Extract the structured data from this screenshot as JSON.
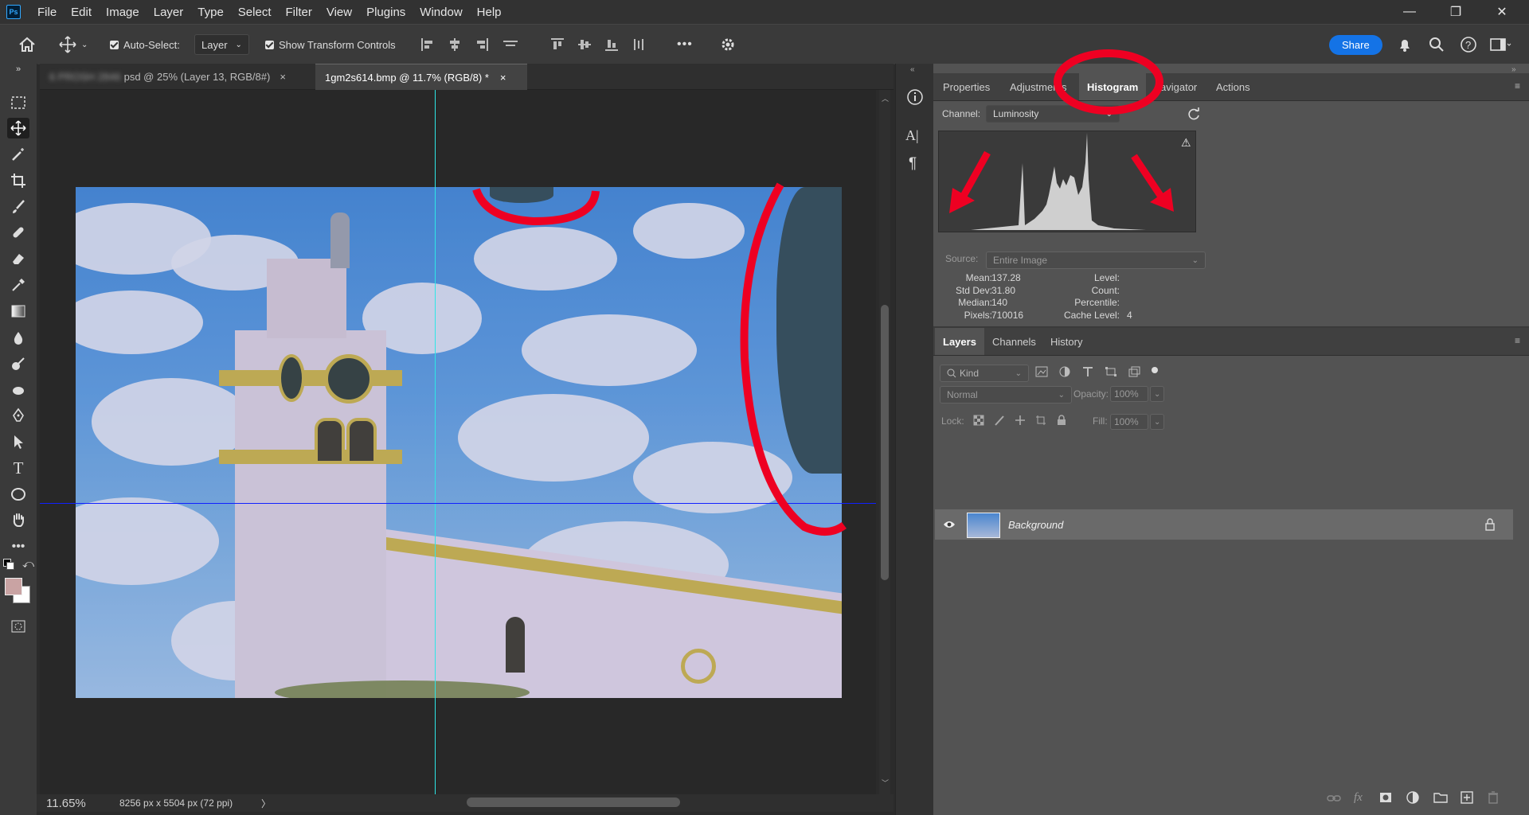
{
  "app": {
    "logo": "Ps"
  },
  "menu": [
    "File",
    "Edit",
    "Image",
    "Layer",
    "Type",
    "Select",
    "Filter",
    "View",
    "Plugins",
    "Window",
    "Help"
  ],
  "window_controls": {
    "minimize": "—",
    "maximize": "❐",
    "close": "✕"
  },
  "options_bar": {
    "auto_select_label": "Auto-Select:",
    "auto_select_value": "Layer",
    "show_transform_label": "Show Transform Controls",
    "more": "•••",
    "share": "Share"
  },
  "tabs": [
    {
      "title": "psd @ 25% (Layer 13, RGB/8#)",
      "blurred_prefix": "6 PROSH 2846",
      "close": "×"
    },
    {
      "title": "1gm2s614.bmp @ 11.7% (RGB/8) *",
      "close": "×"
    }
  ],
  "status": {
    "zoom": "11.65%",
    "doc_size": "8256 px x 5504 px (72 ppi)",
    "arrow": "〉"
  },
  "histogram_panel": {
    "tabs": [
      "Properties",
      "Adjustments",
      "Histogram",
      "Navigator",
      "Actions"
    ],
    "tab_labels_visible": [
      "Properties",
      "Adjustme",
      "nts",
      "Histogram",
      "avigator",
      "Actions"
    ],
    "channel_label": "Channel:",
    "channel_value": "Luminosity",
    "source_label": "Source:",
    "source_value": "Entire Image",
    "stats": {
      "mean_label": "Mean:",
      "mean": "137.28",
      "std_label": "Std Dev:",
      "std": "31.80",
      "median_label": "Median:",
      "median": "140",
      "pixels_label": "Pixels:",
      "pixels": "710016",
      "level_label": "Level:",
      "count_label": "Count:",
      "percentile_label": "Percentile:",
      "cache_label": "Cache Level:",
      "cache": "4"
    },
    "warning_icon": "⚠"
  },
  "layers_panel": {
    "tabs": [
      "Layers",
      "Channels",
      "History"
    ],
    "kind_placeholder": "Kind",
    "blend_mode": "Normal",
    "opacity_label": "Opacity:",
    "opacity": "100%",
    "lock_label": "Lock:",
    "fill_label": "Fill:",
    "fill": "100%",
    "layers": [
      {
        "name": "Background",
        "visible": true,
        "locked": true
      }
    ],
    "footer_icons": [
      "link-icon",
      "fx-icon",
      "mask-icon",
      "adjustment-icon",
      "folder-icon",
      "new-layer-icon",
      "trash-icon"
    ]
  },
  "colors": {
    "accent": "#1473e6",
    "annotation_red": "#ee0022",
    "guide_cyan": "#2ee6e6",
    "guide_blue": "#1020ff"
  }
}
